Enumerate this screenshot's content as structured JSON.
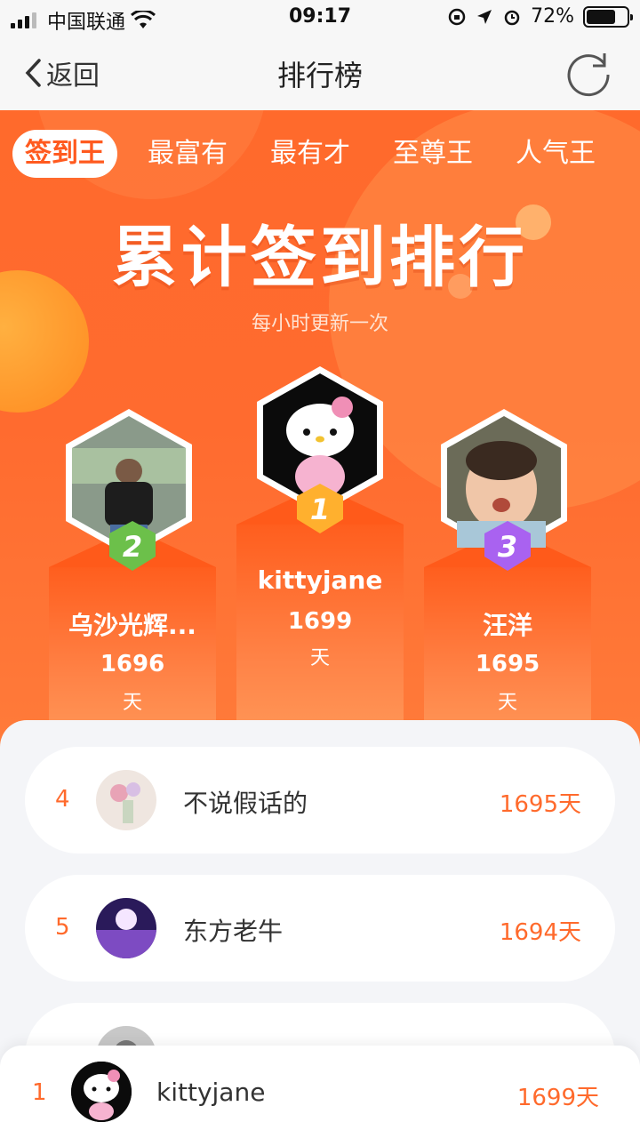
{
  "status": {
    "carrier": "中国联通",
    "time": "09:17",
    "battery": "72%",
    "battery_level": 0.72
  },
  "nav": {
    "back_label": "返回",
    "title": "排行榜"
  },
  "tabs": [
    "签到王",
    "最富有",
    "最有才",
    "至尊王",
    "人气王"
  ],
  "hero": {
    "title": "累计签到排行",
    "subtitle": "每小时更新一次"
  },
  "podium": {
    "first": {
      "rank": "1",
      "name": "kittyjane",
      "score": "1699",
      "unit": "天"
    },
    "second": {
      "rank": "2",
      "name": "乌沙光辉...",
      "score": "1696",
      "unit": "天"
    },
    "third": {
      "rank": "3",
      "name": "汪洋",
      "score": "1695",
      "unit": "天"
    }
  },
  "list": [
    {
      "rank": "4",
      "name": "不说假话的",
      "days": "1695天"
    },
    {
      "rank": "5",
      "name": "东方老牛",
      "days": "1694天"
    }
  ],
  "me": {
    "rank": "1",
    "name": "kittyjane",
    "days": "1699天"
  },
  "colors": {
    "accent": "#ff6a2c",
    "tab_active_text": "#ff5a1f",
    "medal_gold": "#ffb02e",
    "medal_silver": "#6cc04a",
    "medal_bronze": "#a962f0"
  }
}
